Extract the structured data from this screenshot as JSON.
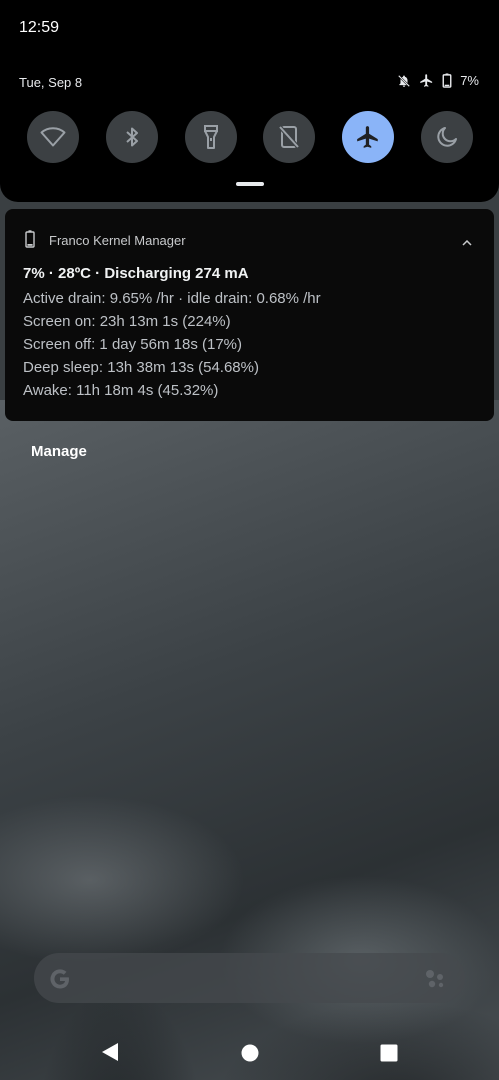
{
  "status_bar": {
    "time": "12:59",
    "battery_percent": "7%"
  },
  "quick_settings": {
    "date": "Tue, Sep 8",
    "tiles": [
      {
        "name": "wifi",
        "active": false
      },
      {
        "name": "bluetooth",
        "active": false
      },
      {
        "name": "flashlight",
        "active": false
      },
      {
        "name": "auto-rotate",
        "active": false
      },
      {
        "name": "airplane-mode",
        "active": true
      },
      {
        "name": "night-mode",
        "active": false
      }
    ],
    "accent_color": "#8ab4f8"
  },
  "notification": {
    "app_name": "Franco Kernel Manager",
    "title": "7% · 28ºC · Discharging 274 mA",
    "lines": [
      "Active drain: 9.65% /hr · idle drain: 0.68% /hr",
      "Screen on: 23h 13m 1s  (224%)",
      "Screen off: 1 day 56m 18s  (17%)",
      "Deep sleep: 13h 38m 13s  (54.68%)",
      "Awake: 11h 18m 4s  (45.32%)"
    ]
  },
  "manage_label": "Manage"
}
